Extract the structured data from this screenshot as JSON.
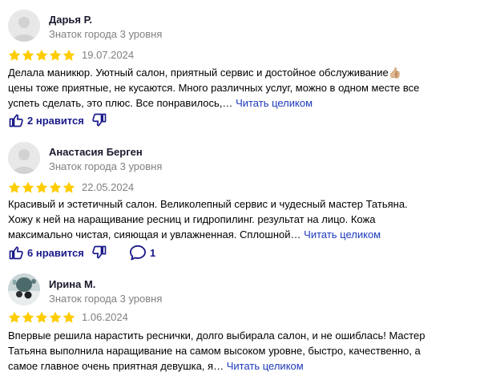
{
  "reviews": [
    {
      "author": "Дарья Р.",
      "level": "Знаток города 3 уровня",
      "rating": 5,
      "date": "19.07.2024",
      "text_lines": [
        "Делала маникюр. Уютный салон, приятный сервис и достойное обслуживание👍🏼",
        "цены тоже приятные, не кусаются. Много различных услуг, можно в одном месте все",
        "успеть сделать, это плюс. Все понравилось,…"
      ],
      "read_more": "Читать целиком",
      "likes": "2 нравится"
    },
    {
      "author": "Анастасия Берген",
      "level": "Знаток города 3 уровня",
      "rating": 5,
      "date": "22.05.2024",
      "text_lines": [
        "Красивый и эстетичный салон. Великолепный сервис и чудесный мастер Татьяна.",
        "Хожу к ней на наращивание ресниц и гидропилинг. результат на лицо. Кожа",
        "максимально чистая, сияющая и увлажненная. Сплошной…"
      ],
      "read_more": "Читать целиком",
      "likes": "6 нравится",
      "comments": "1"
    },
    {
      "author": "Ирина М.",
      "level": "Знаток города 3 уровня",
      "rating": 5,
      "date": "1.06.2024",
      "text_lines": [
        "Впервые решила нарастить реснички, долго выбирала салон, и не ошиблась! Мастер",
        "Татьяна выполнила наращивание на самом высоком уровне, быстро, качественно, а",
        "самое главное очень приятная девушка, я…"
      ],
      "read_more": "Читать целиком"
    }
  ],
  "colors": {
    "star": "#fc0",
    "link": "#1c39bb",
    "muted": "#808080"
  },
  "icons": {
    "like": "thumb-up-icon",
    "dislike": "thumb-down-icon",
    "comment": "comment-bubble-icon"
  }
}
